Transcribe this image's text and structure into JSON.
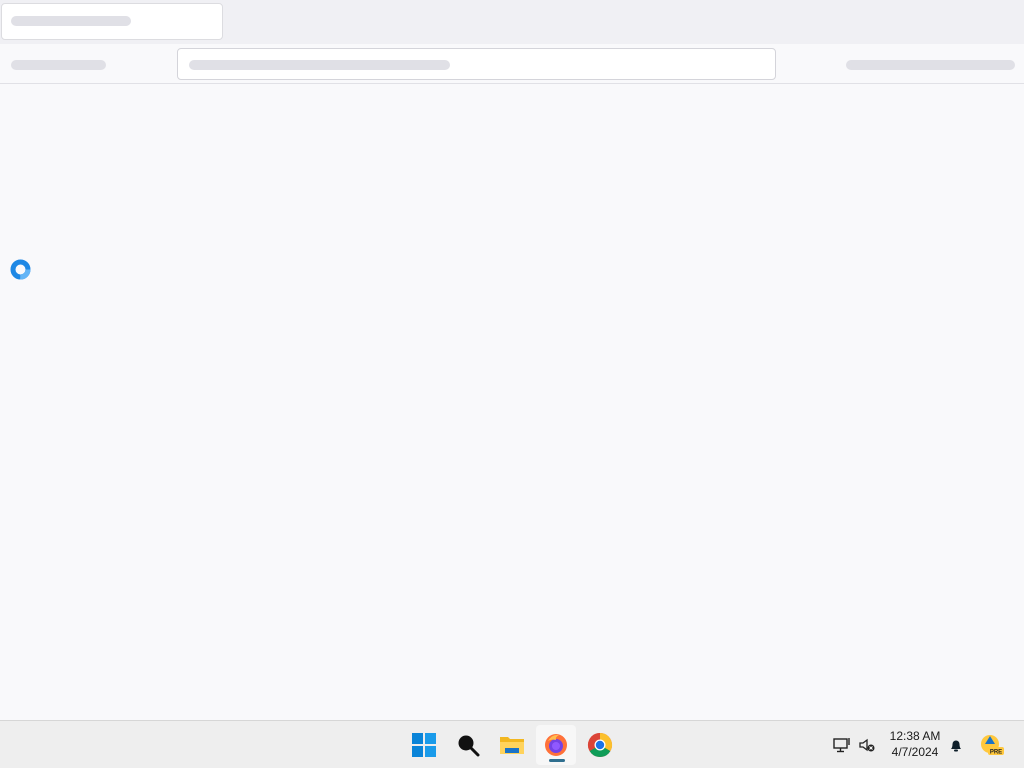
{
  "browser": {
    "tab": {
      "title": "",
      "state": "loading"
    },
    "address_bar": {
      "value": ""
    }
  },
  "content": {
    "loading_indicator": {
      "color": "#1e88e5"
    }
  },
  "taskbar": {
    "apps": [
      {
        "name": "start",
        "icon": "windows-icon"
      },
      {
        "name": "search",
        "icon": "search-icon"
      },
      {
        "name": "file-explorer",
        "icon": "folder-icon"
      },
      {
        "name": "firefox",
        "icon": "firefox-icon",
        "active": true
      },
      {
        "name": "chrome",
        "icon": "chrome-icon"
      }
    ],
    "tray": {
      "network_icon": "network-icon",
      "volume_icon": "volume-muted-icon",
      "notification_icon": "bell-icon",
      "pre_badge": "PRE"
    },
    "clock": {
      "time": "12:38 AM",
      "date": "4/7/2024"
    }
  },
  "colors": {
    "accent": "#0078d4",
    "taskbar_bg": "#eeeeee",
    "page_bg": "#f9f9fb"
  }
}
